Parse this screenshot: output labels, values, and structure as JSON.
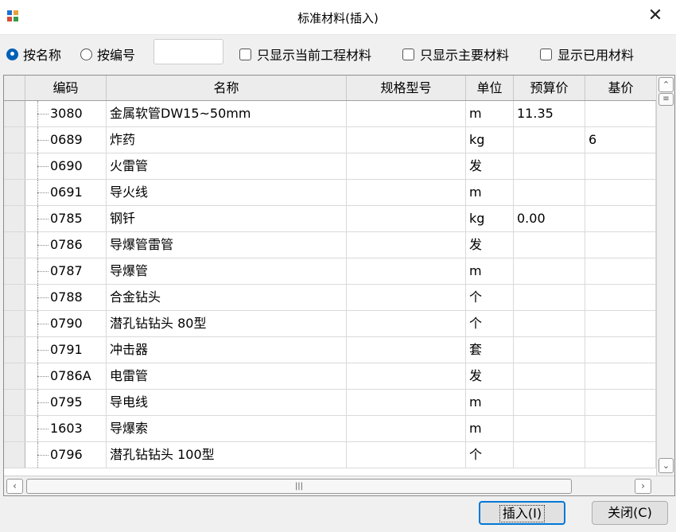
{
  "window": {
    "title": "标准材料(插入)"
  },
  "filters": {
    "by_name_label": "按名称",
    "by_code_label": "按编号",
    "search_value": "",
    "only_project_label": "只显示当前工程材料",
    "only_main_label": "只显示主要材料",
    "show_used_label": "显示已用材料"
  },
  "columns": [
    "编码",
    "名称",
    "规格型号",
    "单位",
    "预算价",
    "基价"
  ],
  "rows": [
    {
      "code": "3080",
      "name": "金属软管DW15~50mm",
      "spec": "",
      "unit": "m",
      "budget_price": "11.35",
      "base_price": ""
    },
    {
      "code": "0689",
      "name": "炸药",
      "spec": "",
      "unit": "kg",
      "budget_price": "",
      "base_price": "6"
    },
    {
      "code": "0690",
      "name": "火雷管",
      "spec": "",
      "unit": "发",
      "budget_price": "",
      "base_price": ""
    },
    {
      "code": "0691",
      "name": "导火线",
      "spec": "",
      "unit": "m",
      "budget_price": "",
      "base_price": ""
    },
    {
      "code": "0785",
      "name": "钢钎",
      "spec": "",
      "unit": "kg",
      "budget_price": "0.00",
      "base_price": ""
    },
    {
      "code": "0786",
      "name": "导爆管雷管",
      "spec": "",
      "unit": "发",
      "budget_price": "",
      "base_price": ""
    },
    {
      "code": "0787",
      "name": "导爆管",
      "spec": "",
      "unit": "m",
      "budget_price": "",
      "base_price": ""
    },
    {
      "code": "0788",
      "name": "合金钻头",
      "spec": "",
      "unit": "个",
      "budget_price": "",
      "base_price": ""
    },
    {
      "code": "0790",
      "name": "潜孔钻钻头 80型",
      "spec": "",
      "unit": "个",
      "budget_price": "",
      "base_price": ""
    },
    {
      "code": "0791",
      "name": "冲击器",
      "spec": "",
      "unit": "套",
      "budget_price": "",
      "base_price": ""
    },
    {
      "code": "0786A",
      "name": "电雷管",
      "spec": "",
      "unit": "发",
      "budget_price": "",
      "base_price": ""
    },
    {
      "code": "0795",
      "name": "导电线",
      "spec": "",
      "unit": "m",
      "budget_price": "",
      "base_price": ""
    },
    {
      "code": "1603",
      "name": "导爆索",
      "spec": "",
      "unit": "m",
      "budget_price": "",
      "base_price": ""
    },
    {
      "code": "0796",
      "name": "潜孔钻钻头 100型",
      "spec": "",
      "unit": "个",
      "budget_price": "",
      "base_price": ""
    }
  ],
  "buttons": {
    "insert_label": "插入(I)",
    "close_label": "关闭(C)"
  },
  "colors": {
    "accent": "#005fb8",
    "header_bg": "#ececec",
    "focus_border": "#0078d7"
  }
}
